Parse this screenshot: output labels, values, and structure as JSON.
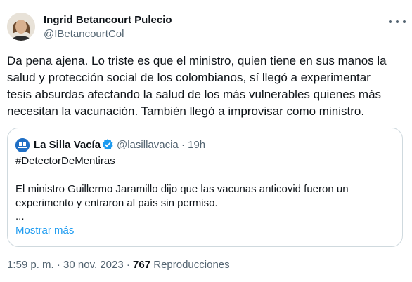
{
  "author": {
    "name": "Ingrid Betancourt Pulecio",
    "handle": "@IBetancourtCol"
  },
  "tweet": {
    "lines": [
      "Da pena ajena. Lo triste es que el ministro, quien tiene en sus manos la",
      "salud y protección social de los colombianos, sí llegó a experimentar",
      "tesis absurdas afectando la salud de los más vulnerables quienes más",
      "necesitan la vacunación. También llegó a improvisar como ministro."
    ]
  },
  "quoted": {
    "name": "La Silla Vacía",
    "handle": "@lasillavacia",
    "separator": "·",
    "time": "19h",
    "hashtag": "#DetectorDeMentiras",
    "body_lines": [
      "El ministro Guillermo Jaramillo dijo que las vacunas anticovid fueron un",
      "experimento y entraron al país sin permiso."
    ],
    "ellipsis": "...",
    "show_more": "Mostrar más"
  },
  "meta": {
    "time": "1:59 p. m.",
    "separator1": "·",
    "date": "30 nov. 2023",
    "separator2": "·",
    "views_count": "767",
    "views_label": "Reproducciones"
  },
  "icons": {
    "more": "more-dots-icon",
    "verified": "verified-badge-icon"
  },
  "colors": {
    "text": "#0f1419",
    "secondary": "#536471",
    "link": "#1d9bf0",
    "border": "#cfd9de"
  }
}
